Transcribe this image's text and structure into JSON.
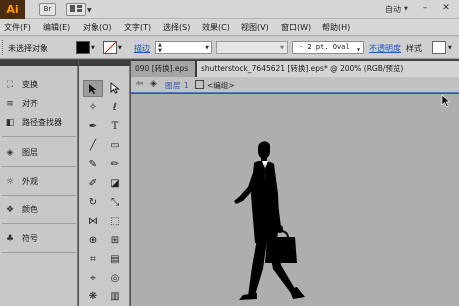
{
  "app": {
    "logo_text": "Ai",
    "brand_color": "#ff9a00",
    "logo_bg": "#4a2c11",
    "bridge_icon_label": "Br",
    "workspace_switcher_icon": "layout-icon",
    "workspace_label": "自动",
    "window_minimize": "–",
    "window_close": "✕"
  },
  "menu": {
    "items": [
      "文件(F)",
      "编辑(E)",
      "对象(O)",
      "文字(T)",
      "选择(S)",
      "效果(C)",
      "视图(V)",
      "窗口(W)",
      "帮助(H)"
    ]
  },
  "control_bar": {
    "selection_label": "未选择对象",
    "fill_color": "#000000",
    "stroke_color": "none",
    "stroke_label": "描边",
    "stroke_weight_value": "",
    "variable_width_value": "",
    "brush_definition": "· 2 pt. Oval",
    "opacity_label": "不透明度",
    "style_label": "样式"
  },
  "left_panel": {
    "items": [
      {
        "icon": "transform-icon",
        "glyph": "⛶",
        "label": "变换"
      },
      {
        "icon": "align-icon",
        "glyph": "≡",
        "label": "对齐"
      },
      {
        "icon": "pathfinder-icon",
        "glyph": "◧",
        "label": "路径查找器"
      },
      {
        "icon": "layers-icon",
        "glyph": "◈",
        "label": "图层"
      },
      {
        "icon": "appearance-icon",
        "glyph": "☼",
        "label": "外观"
      },
      {
        "icon": "color-icon",
        "glyph": "❖",
        "label": "颜色"
      },
      {
        "icon": "symbols-icon",
        "glyph": "♣",
        "label": "符号"
      }
    ]
  },
  "document": {
    "tabs": [
      {
        "label": "090 [转换].eps",
        "close": ""
      },
      {
        "label": "shutterstock_7645621 [转换].eps* @ 200% (RGB/预览)",
        "close": "✕"
      }
    ],
    "breadcrumb": {
      "layer_name": "图层 1",
      "group_name": "<编组>"
    },
    "canvas_color": "#aeaeae"
  }
}
